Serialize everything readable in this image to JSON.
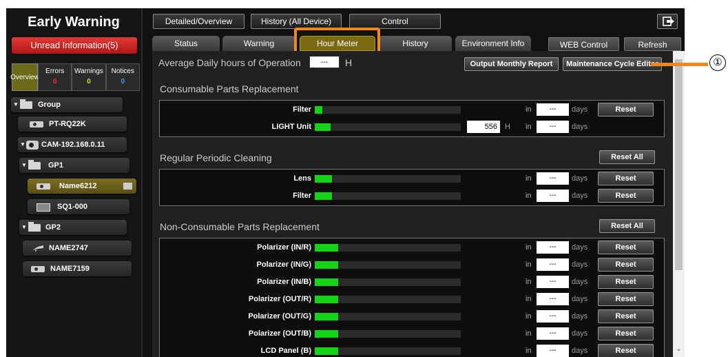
{
  "sidebar": {
    "title": "Early Warning",
    "unread_label": "Unread Information(5)",
    "counts": {
      "overview_label": "Overview",
      "errors_label": "Errors",
      "errors_value": "0",
      "warnings_label": "Warnings",
      "warnings_value": "0",
      "notices_label": "Notices",
      "notices_value": "0"
    },
    "tree": [
      {
        "label": "Group"
      },
      {
        "label": "PT-RQ22K"
      },
      {
        "label": "CAM-192.168.0.11"
      },
      {
        "label": "GP1"
      },
      {
        "label": "Name6212"
      },
      {
        "label": "SQ1-000"
      },
      {
        "label": "GP2"
      },
      {
        "label": "NAME2747"
      },
      {
        "label": "NAME7159"
      }
    ]
  },
  "topbar": {
    "detailed": "Detailed/Overview",
    "history_all": "History (All Device)",
    "control": "Control"
  },
  "tabs": {
    "status": "Status",
    "warning": "Warning",
    "hour_meter": "Hour Meter",
    "history": "History",
    "environment": "Environment Info",
    "web_control": "WEB Control",
    "refresh": "Refresh"
  },
  "main": {
    "avg_label": "Average Daily hours of Operation",
    "avg_value": "---",
    "avg_unit": "H",
    "output_report": "Output Monthly Report",
    "maintenance_editor": "Maintenance Cycle Editor",
    "in_label": "in",
    "days_label": "days",
    "days_value": "---",
    "reset_label": "Reset",
    "reset_all_label": "Reset All",
    "consumable": {
      "title": "Consumable Parts Replacement",
      "rows": [
        {
          "name": "Filter",
          "level": 0.05
        },
        {
          "name": "LIGHT Unit",
          "level": 0.11,
          "hours": "556",
          "hours_unit": "H"
        }
      ]
    },
    "cleaning": {
      "title": "Regular Periodic Cleaning",
      "rows": [
        {
          "name": "Lens",
          "level": 0.12
        },
        {
          "name": "Filter",
          "level": 0.12
        }
      ]
    },
    "nonconsumable": {
      "title": "Non-Consumable Parts Replacement",
      "rows": [
        {
          "name": "Polarizer (IN/R)",
          "level": 0.16
        },
        {
          "name": "Polarizer (IN/G)",
          "level": 0.16
        },
        {
          "name": "Polarizer (IN/B)",
          "level": 0.16
        },
        {
          "name": "Polarizer (OUT/R)",
          "level": 0.16
        },
        {
          "name": "Polarizer (OUT/G)",
          "level": 0.16
        },
        {
          "name": "Polarizer (OUT/B)",
          "level": 0.16
        },
        {
          "name": "LCD Panel (B)",
          "level": 0.16
        }
      ]
    }
  },
  "callout": {
    "number": "①"
  },
  "colors": {
    "accent": "#f0881e",
    "bar": "#12d412",
    "alert": "#e23a36"
  }
}
